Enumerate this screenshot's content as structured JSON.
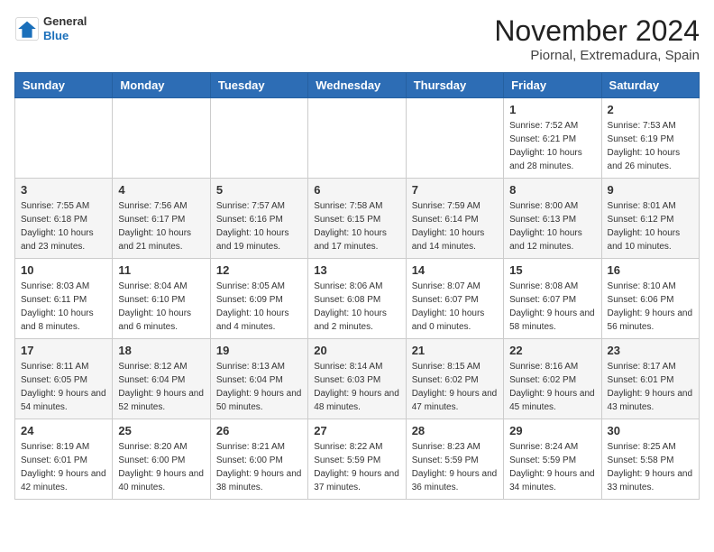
{
  "header": {
    "logo": {
      "general": "General",
      "blue": "Blue"
    },
    "title": "November 2024",
    "location": "Piornal, Extremadura, Spain"
  },
  "weekdays": [
    "Sunday",
    "Monday",
    "Tuesday",
    "Wednesday",
    "Thursday",
    "Friday",
    "Saturday"
  ],
  "weeks": [
    [
      {
        "day": "",
        "info": ""
      },
      {
        "day": "",
        "info": ""
      },
      {
        "day": "",
        "info": ""
      },
      {
        "day": "",
        "info": ""
      },
      {
        "day": "",
        "info": ""
      },
      {
        "day": "1",
        "info": "Sunrise: 7:52 AM\nSunset: 6:21 PM\nDaylight: 10 hours and 28 minutes."
      },
      {
        "day": "2",
        "info": "Sunrise: 7:53 AM\nSunset: 6:19 PM\nDaylight: 10 hours and 26 minutes."
      }
    ],
    [
      {
        "day": "3",
        "info": "Sunrise: 7:55 AM\nSunset: 6:18 PM\nDaylight: 10 hours and 23 minutes."
      },
      {
        "day": "4",
        "info": "Sunrise: 7:56 AM\nSunset: 6:17 PM\nDaylight: 10 hours and 21 minutes."
      },
      {
        "day": "5",
        "info": "Sunrise: 7:57 AM\nSunset: 6:16 PM\nDaylight: 10 hours and 19 minutes."
      },
      {
        "day": "6",
        "info": "Sunrise: 7:58 AM\nSunset: 6:15 PM\nDaylight: 10 hours and 17 minutes."
      },
      {
        "day": "7",
        "info": "Sunrise: 7:59 AM\nSunset: 6:14 PM\nDaylight: 10 hours and 14 minutes."
      },
      {
        "day": "8",
        "info": "Sunrise: 8:00 AM\nSunset: 6:13 PM\nDaylight: 10 hours and 12 minutes."
      },
      {
        "day": "9",
        "info": "Sunrise: 8:01 AM\nSunset: 6:12 PM\nDaylight: 10 hours and 10 minutes."
      }
    ],
    [
      {
        "day": "10",
        "info": "Sunrise: 8:03 AM\nSunset: 6:11 PM\nDaylight: 10 hours and 8 minutes."
      },
      {
        "day": "11",
        "info": "Sunrise: 8:04 AM\nSunset: 6:10 PM\nDaylight: 10 hours and 6 minutes."
      },
      {
        "day": "12",
        "info": "Sunrise: 8:05 AM\nSunset: 6:09 PM\nDaylight: 10 hours and 4 minutes."
      },
      {
        "day": "13",
        "info": "Sunrise: 8:06 AM\nSunset: 6:08 PM\nDaylight: 10 hours and 2 minutes."
      },
      {
        "day": "14",
        "info": "Sunrise: 8:07 AM\nSunset: 6:07 PM\nDaylight: 10 hours and 0 minutes."
      },
      {
        "day": "15",
        "info": "Sunrise: 8:08 AM\nSunset: 6:07 PM\nDaylight: 9 hours and 58 minutes."
      },
      {
        "day": "16",
        "info": "Sunrise: 8:10 AM\nSunset: 6:06 PM\nDaylight: 9 hours and 56 minutes."
      }
    ],
    [
      {
        "day": "17",
        "info": "Sunrise: 8:11 AM\nSunset: 6:05 PM\nDaylight: 9 hours and 54 minutes."
      },
      {
        "day": "18",
        "info": "Sunrise: 8:12 AM\nSunset: 6:04 PM\nDaylight: 9 hours and 52 minutes."
      },
      {
        "day": "19",
        "info": "Sunrise: 8:13 AM\nSunset: 6:04 PM\nDaylight: 9 hours and 50 minutes."
      },
      {
        "day": "20",
        "info": "Sunrise: 8:14 AM\nSunset: 6:03 PM\nDaylight: 9 hours and 48 minutes."
      },
      {
        "day": "21",
        "info": "Sunrise: 8:15 AM\nSunset: 6:02 PM\nDaylight: 9 hours and 47 minutes."
      },
      {
        "day": "22",
        "info": "Sunrise: 8:16 AM\nSunset: 6:02 PM\nDaylight: 9 hours and 45 minutes."
      },
      {
        "day": "23",
        "info": "Sunrise: 8:17 AM\nSunset: 6:01 PM\nDaylight: 9 hours and 43 minutes."
      }
    ],
    [
      {
        "day": "24",
        "info": "Sunrise: 8:19 AM\nSunset: 6:01 PM\nDaylight: 9 hours and 42 minutes."
      },
      {
        "day": "25",
        "info": "Sunrise: 8:20 AM\nSunset: 6:00 PM\nDaylight: 9 hours and 40 minutes."
      },
      {
        "day": "26",
        "info": "Sunrise: 8:21 AM\nSunset: 6:00 PM\nDaylight: 9 hours and 38 minutes."
      },
      {
        "day": "27",
        "info": "Sunrise: 8:22 AM\nSunset: 5:59 PM\nDaylight: 9 hours and 37 minutes."
      },
      {
        "day": "28",
        "info": "Sunrise: 8:23 AM\nSunset: 5:59 PM\nDaylight: 9 hours and 36 minutes."
      },
      {
        "day": "29",
        "info": "Sunrise: 8:24 AM\nSunset: 5:59 PM\nDaylight: 9 hours and 34 minutes."
      },
      {
        "day": "30",
        "info": "Sunrise: 8:25 AM\nSunset: 5:58 PM\nDaylight: 9 hours and 33 minutes."
      }
    ]
  ]
}
